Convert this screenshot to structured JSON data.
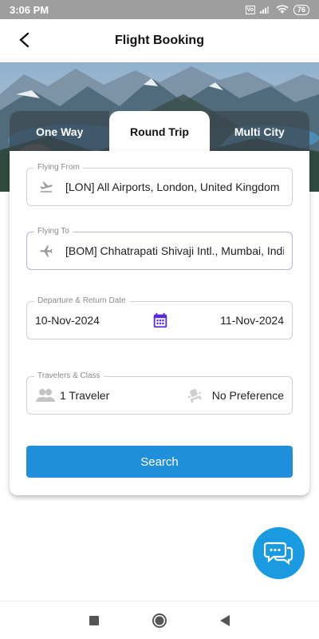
{
  "status_bar": {
    "time": "3:06 PM",
    "battery": "76",
    "sim_label": "Vo"
  },
  "header": {
    "title": "Flight Booking",
    "back_icon": "arrow-back-icon"
  },
  "tabs": [
    {
      "label": "One Way",
      "active": false
    },
    {
      "label": "Round Trip",
      "active": true
    },
    {
      "label": "Multi City",
      "active": false
    }
  ],
  "form": {
    "from": {
      "label": "Flying From",
      "value": "[LON] All Airports, London, United Kingdom",
      "icon": "airplane-takeoff-icon"
    },
    "to": {
      "label": "Flying To",
      "value": "[BOM] Chhatrapati Shivaji Intl., Mumbai, India",
      "icon": "airplane-landing-icon"
    },
    "dates": {
      "label": "Departure & Return Date",
      "departure": "10-Nov-2024",
      "return": "11-Nov-2024",
      "icon": "calendar-icon"
    },
    "travelers": {
      "label": "Travelers & Class",
      "travelers": "1 Traveler",
      "class": "No Preference",
      "icon": "people-icon",
      "class_icon": "seat-icon"
    },
    "search_label": "Search"
  },
  "colors": {
    "accent": "#1f8fdb",
    "fab": "#1a9ae0",
    "calendar": "#5b2bd6",
    "field_border": "#cfcfd6"
  },
  "chat": {
    "icon": "chat-bubbles-icon"
  },
  "nav": {
    "recents_icon": "square-icon",
    "home_icon": "circle-icon",
    "back_icon": "triangle-back-icon"
  }
}
